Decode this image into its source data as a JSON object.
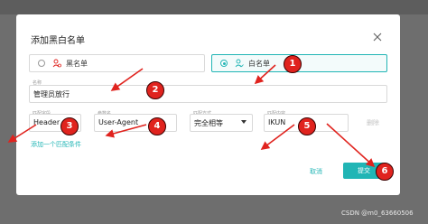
{
  "dialog": {
    "title": "添加黑白名单",
    "close_icon": "close-icon"
  },
  "list_type": {
    "options": [
      {
        "label": "黑名单",
        "icon": "user-blocked-icon",
        "selected": false
      },
      {
        "label": "白名单",
        "icon": "user-allowed-icon",
        "selected": true
      }
    ]
  },
  "name_field": {
    "label": "名称",
    "value": "管理员放行"
  },
  "rule": {
    "match_field_label": "匹配字段",
    "match_field_value": "Header",
    "param_name_label": "参数名",
    "param_name_value": "User-Agent",
    "match_mode_label": "匹配方式",
    "match_mode_value": "完全相等",
    "match_content_label": "匹配内容",
    "match_content_value": "IKUN",
    "delete_label": "删除"
  },
  "add_condition_label": "添加一个匹配条件",
  "footer": {
    "cancel_label": "取消",
    "submit_label": "提交"
  },
  "annotations": [
    "1",
    "2",
    "3",
    "4",
    "5",
    "6"
  ],
  "annotation_color": "#e0231e",
  "accent_color": "#21b5b5",
  "watermark": "CSDN @m0_63660506"
}
